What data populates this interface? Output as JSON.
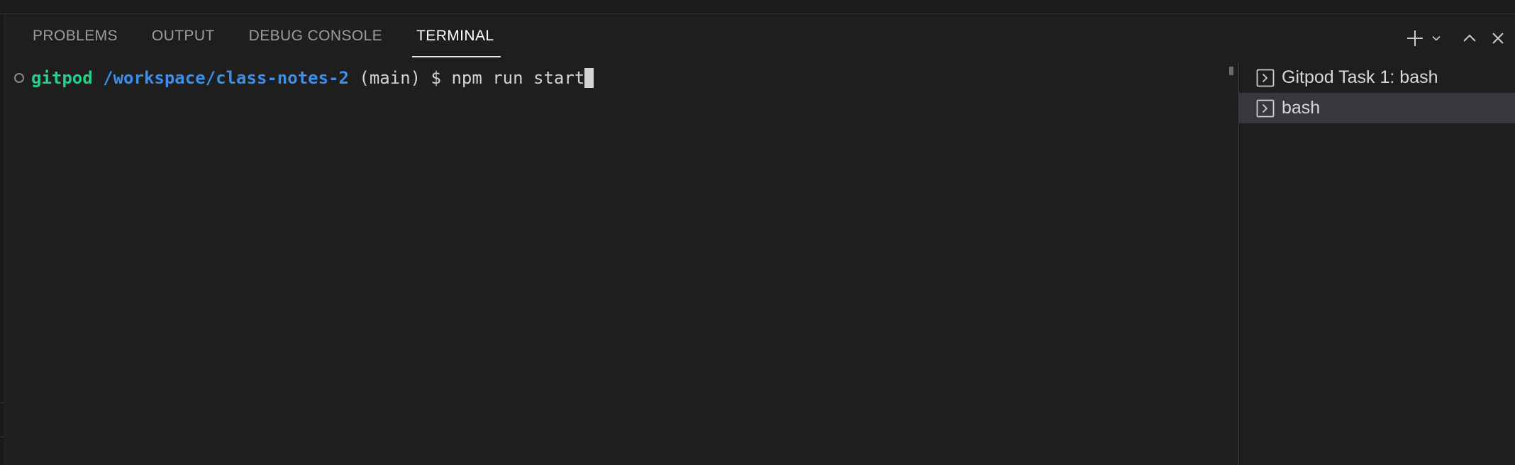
{
  "panel": {
    "tabs": [
      {
        "label": "PROBLEMS",
        "active": false
      },
      {
        "label": "OUTPUT",
        "active": false
      },
      {
        "label": "DEBUG CONSOLE",
        "active": false
      },
      {
        "label": "TERMINAL",
        "active": true
      }
    ],
    "actions": [
      "plus-icon",
      "chevron-down-icon",
      "chevron-up-icon",
      "close-icon"
    ]
  },
  "terminal": {
    "user": "gitpod",
    "path": "/workspace/class-notes-2",
    "branch_and_prompt": "(main) $ ",
    "command": "npm run start"
  },
  "terminal_list": {
    "items": [
      {
        "label": "Gitpod Task 1: bash",
        "icon": "terminal-icon",
        "selected": false
      },
      {
        "label": "bash",
        "icon": "terminal-icon",
        "selected": true
      }
    ]
  },
  "colors": {
    "background": "#1e1e1e",
    "user": "#23d18b",
    "path": "#3b8eea",
    "selected_item": "#37373d"
  }
}
